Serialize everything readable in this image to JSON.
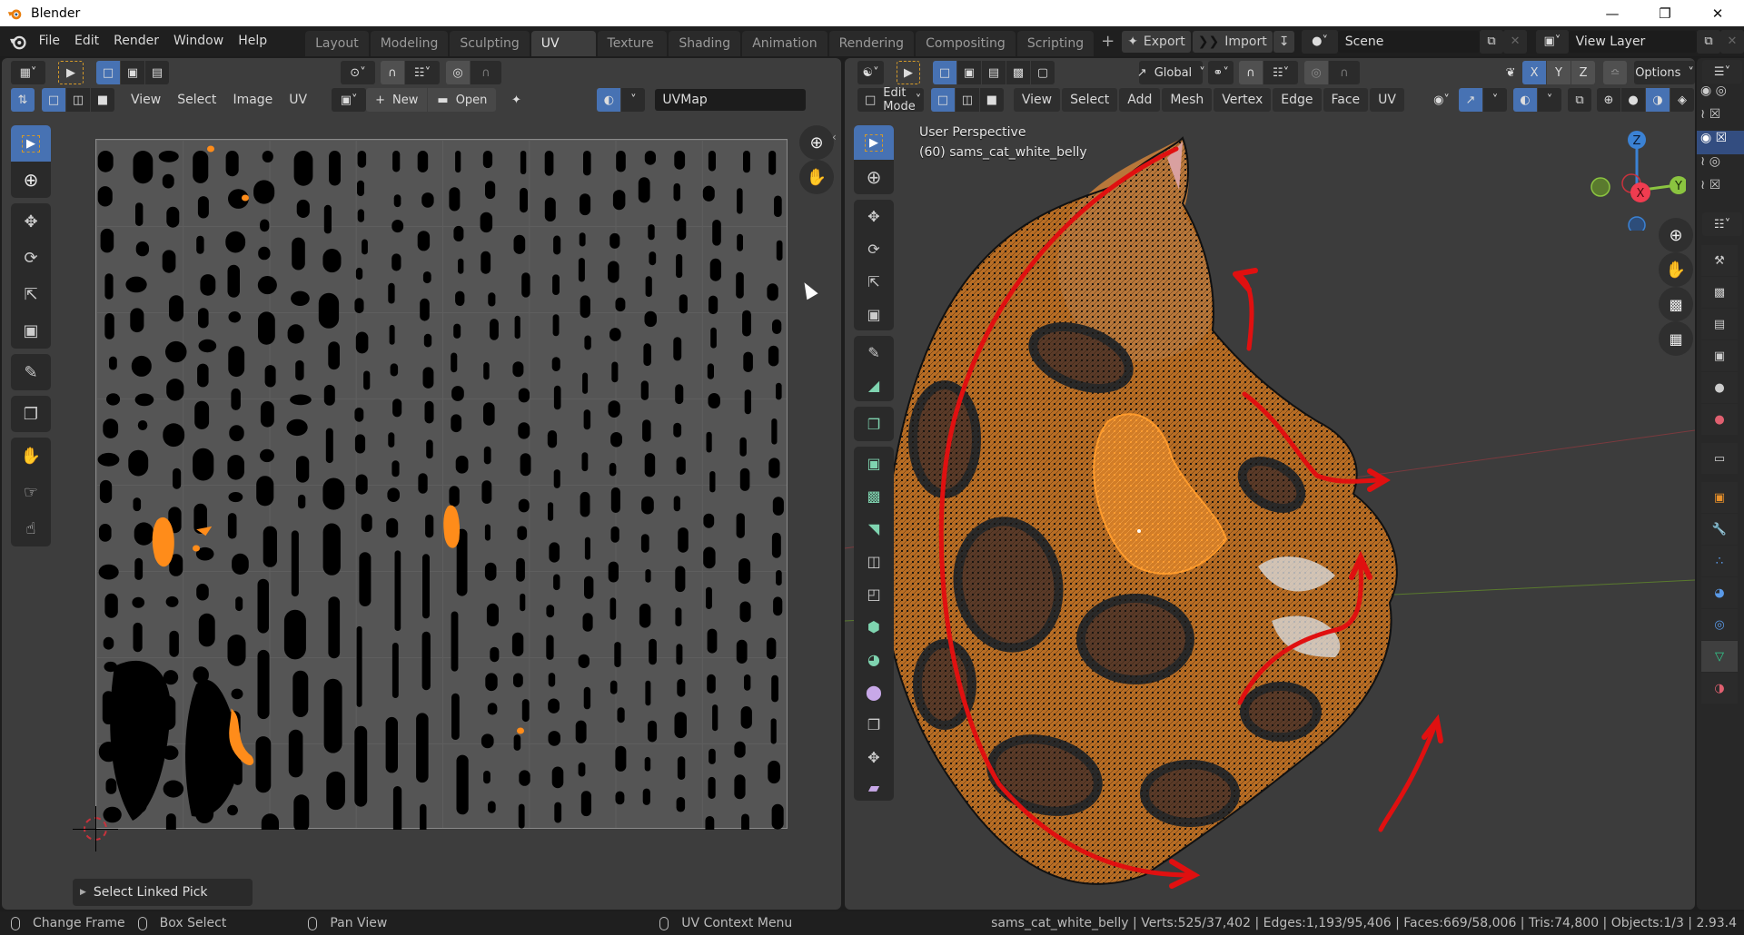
{
  "window": {
    "title": "Blender",
    "controls": [
      "minimize",
      "maximize",
      "close"
    ]
  },
  "topbar": {
    "menus": [
      "File",
      "Edit",
      "Render",
      "Window",
      "Help"
    ],
    "workspace_tabs": [
      {
        "label": "Layout",
        "active": false
      },
      {
        "label": "Modeling",
        "active": false
      },
      {
        "label": "Sculpting",
        "active": false
      },
      {
        "label": "UV Editing",
        "active": true
      },
      {
        "label": "Texture Paint",
        "active": false
      },
      {
        "label": "Shading",
        "active": false
      },
      {
        "label": "Animation",
        "active": false
      },
      {
        "label": "Rendering",
        "active": false
      },
      {
        "label": "Compositing",
        "active": false
      },
      {
        "label": "Scripting",
        "active": false
      }
    ],
    "add_tab": "+",
    "export_label": "Export",
    "import_label": "Import",
    "scene_name": "Scene",
    "view_layer": "View Layer"
  },
  "uv_editor": {
    "menus": [
      "View",
      "Select",
      "Image",
      "UV"
    ],
    "new_label": "New",
    "open_label": "Open",
    "uvmap_name": "UVMap",
    "last_operator": "Select Linked Pick",
    "tools": [
      "select-box",
      "cursor",
      "move",
      "rotate",
      "scale",
      "transform",
      "annotate",
      "rip-region",
      "grab",
      "relax",
      "pinch"
    ]
  },
  "viewport": {
    "mode": "Edit Mode",
    "menus": [
      "View",
      "Select",
      "Add",
      "Mesh",
      "Vertex",
      "Edge",
      "Face",
      "UV"
    ],
    "orientation": "Global",
    "axes": [
      "X",
      "Y",
      "Z"
    ],
    "options_label": "Options",
    "overlay_line1": "User Perspective",
    "overlay_line2": "(60) sams_cat_white_belly",
    "gizmo": {
      "x": "X",
      "y": "Y",
      "z": "Z"
    },
    "tools": [
      "select-box",
      "cursor",
      "move",
      "rotate",
      "scale",
      "transform",
      "annotate",
      "measure",
      "add-cube",
      "extrude-region",
      "inset-faces",
      "bevel",
      "loop-cut",
      "knife",
      "poly-build",
      "spin",
      "smooth",
      "edge-slide",
      "shrink-fatten",
      "shear"
    ]
  },
  "statusbar": {
    "hints": [
      "Change Frame",
      "Box Select",
      "Pan View",
      "UV Context Menu"
    ],
    "stats": "sams_cat_white_belly | Verts:525/37,402 | Edges:1,193/95,406 | Faces:669/58,006 | Tris:74,800 | Objects:1/3 | 2.93.4"
  },
  "colors": {
    "accent": "#4772b3",
    "selection": "#ff8c1a",
    "annotation": "#e01010"
  }
}
